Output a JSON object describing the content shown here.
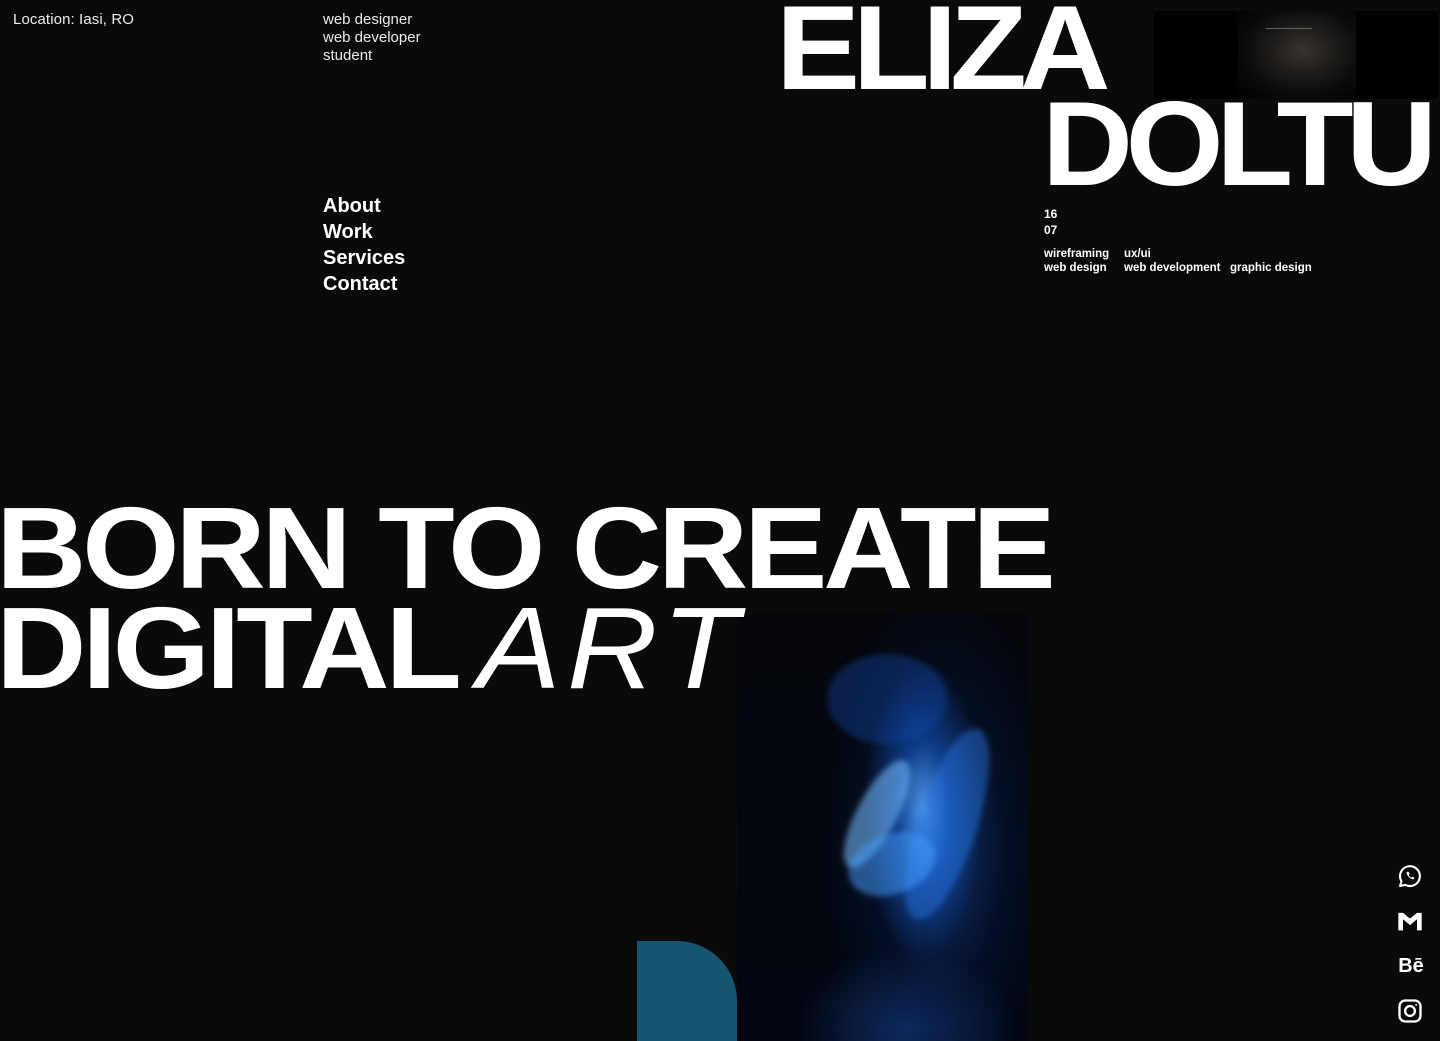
{
  "header": {
    "location": "Location: Iasi, RO",
    "roles": [
      "web designer",
      "web developer",
      "student"
    ]
  },
  "nav": {
    "items": [
      {
        "label": "About"
      },
      {
        "label": "Work"
      },
      {
        "label": "Services"
      },
      {
        "label": "Contact"
      }
    ]
  },
  "identity": {
    "first_name": "ELIZA",
    "last_name": "DOLTU"
  },
  "date": {
    "day": "16",
    "month": "07"
  },
  "skills": {
    "row1": [
      "wireframing",
      "ux/ui"
    ],
    "row2": [
      "web design",
      "web development",
      "graphic design"
    ]
  },
  "hero": {
    "line1": "BORN TO CREATE",
    "line2_bold": "DIGITAL",
    "line2_light": "ART"
  },
  "socials": {
    "items": [
      {
        "icon": "whatsapp-icon"
      },
      {
        "icon": "gmail-icon"
      },
      {
        "icon": "behance-icon",
        "text": "Bē"
      },
      {
        "icon": "instagram-icon"
      }
    ]
  },
  "colors": {
    "background": "#0a0a0a",
    "text": "#ffffff",
    "accent_blob": "#17546f",
    "photo_blue": "#2a7fe0"
  }
}
